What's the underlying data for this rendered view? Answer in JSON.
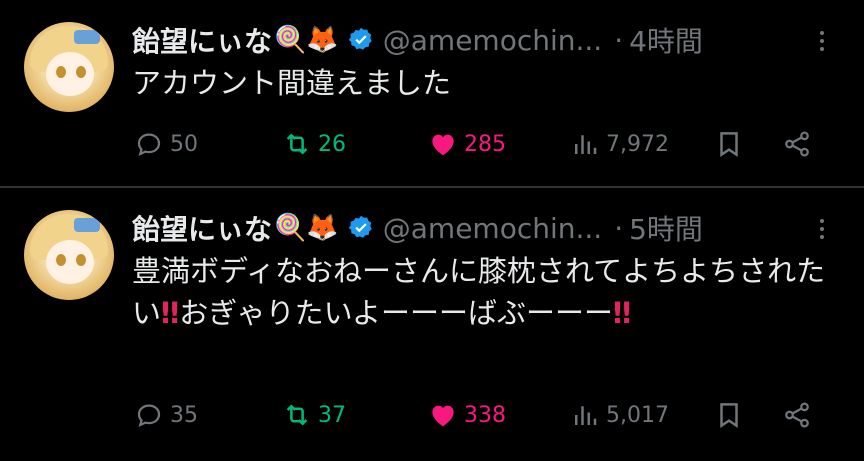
{
  "tweets": [
    {
      "name": "飴望にぃな",
      "emoji": "🍭🦊",
      "handle": "@amemochin...",
      "separator": "·",
      "time": "4時間",
      "text": "アカウント間違えました",
      "text_tail": "",
      "replies": "50",
      "retweets": "26",
      "likes": "285",
      "views": "7,972"
    },
    {
      "name": "飴望にぃな",
      "emoji": "🍭🦊",
      "handle": "@amemochin...",
      "separator": "·",
      "time": "5時間",
      "text": "豊満ボディなおねーさんに膝枕されてよちよちされたい",
      "bang1": "‼",
      "text_mid": "おぎゃりたいよーーーばぶーーー",
      "bang2": "‼",
      "replies": "35",
      "retweets": "37",
      "likes": "338",
      "views": "5,017"
    }
  ],
  "colors": {
    "background": "#000000",
    "text": "#e7e9ea",
    "muted": "#71767b",
    "retweet": "#00ba7c",
    "like": "#f91880",
    "verified": "#1d9bf0"
  },
  "icons": [
    "reply-icon",
    "retweet-icon",
    "heart-icon",
    "views-icon",
    "bookmark-icon",
    "share-icon",
    "verified-icon",
    "more-icon"
  ]
}
